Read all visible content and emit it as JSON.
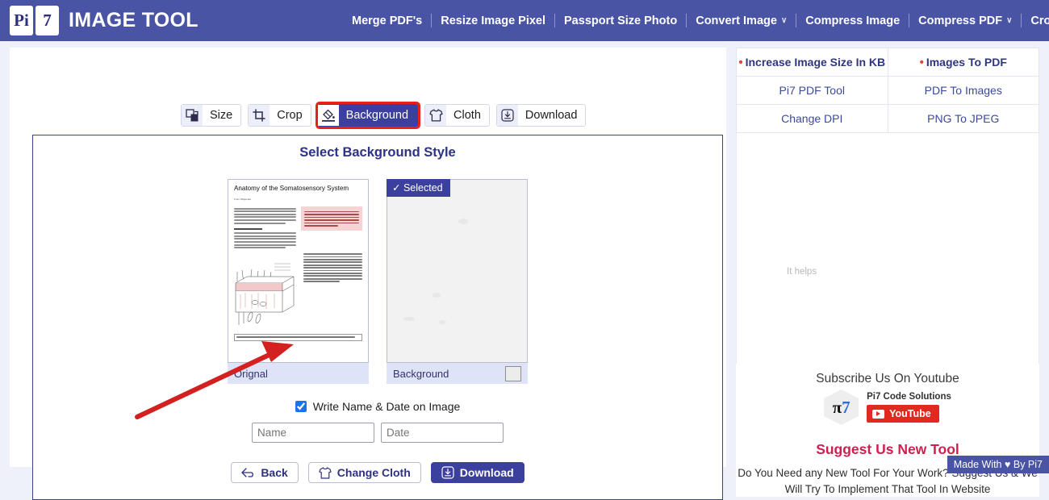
{
  "header": {
    "logo_left": "Pi",
    "logo_right": "7",
    "title": "IMAGE TOOL",
    "nav": [
      {
        "label": "Merge PDF's",
        "caret": false
      },
      {
        "label": "Resize Image Pixel",
        "caret": false
      },
      {
        "label": "Passport Size Photo",
        "caret": false
      },
      {
        "label": "Convert Image",
        "caret": true
      },
      {
        "label": "Compress Image",
        "caret": false
      },
      {
        "label": "Compress PDF",
        "caret": true
      },
      {
        "label": "Crop Image",
        "caret": false
      }
    ],
    "caret_glyph": "∨",
    "bg_color": "#4a54a4"
  },
  "tabs": [
    {
      "label": "Size",
      "icon": "resize-icon",
      "active": false,
      "highlighted": false
    },
    {
      "label": "Crop",
      "icon": "crop-icon",
      "active": false,
      "highlighted": false
    },
    {
      "label": "Background",
      "icon": "paint-bucket-icon",
      "active": true,
      "highlighted": true
    },
    {
      "label": "Cloth",
      "icon": "tshirt-icon",
      "active": false,
      "highlighted": false
    },
    {
      "label": "Download",
      "icon": "download-icon",
      "active": false,
      "highlighted": false
    }
  ],
  "panel": {
    "title": "Select Background Style",
    "thumbnails": [
      {
        "label": "Orignal",
        "selected": false,
        "has_swatch": false,
        "doc": {
          "title": "Anatomy of the Somatosensory System",
          "author": "From Wikipedia",
          "section_heading": "Cutaneous receptors"
        }
      },
      {
        "label": "Background",
        "selected": true,
        "selected_badge": "✓ Selected",
        "has_swatch": true,
        "swatch_color": "#ececec"
      }
    ],
    "checkbox": {
      "label": "Write Name & Date on Image",
      "checked": true
    },
    "inputs": [
      {
        "name": "name",
        "placeholder": "Name",
        "value": ""
      },
      {
        "name": "date",
        "placeholder": "Date",
        "value": ""
      }
    ],
    "buttons": [
      {
        "label": "Back",
        "icon": "back-arrow-icon",
        "primary": false
      },
      {
        "label": "Change Cloth",
        "icon": "tshirt-icon",
        "primary": false
      },
      {
        "label": "Download",
        "icon": "download-icon",
        "primary": true
      }
    ]
  },
  "sidebar": {
    "tools": [
      {
        "label": "Increase Image Size In KB",
        "dot": true,
        "bold": true
      },
      {
        "label": "Images To PDF",
        "dot": true,
        "bold": true
      },
      {
        "label": "Pi7 PDF Tool",
        "dot": false,
        "bold": false
      },
      {
        "label": "PDF To Images",
        "dot": false,
        "bold": false
      },
      {
        "label": "Change DPI",
        "dot": false,
        "bold": false
      },
      {
        "label": "PNG To JPEG",
        "dot": false,
        "bold": false
      }
    ],
    "ad_text": "It helps",
    "subscribe_title": "Subscribe Us On Youtube",
    "channel_name": "Pi7 Code Solutions",
    "youtube_button": "YouTube",
    "logo_pi": "π",
    "logo_seven": "7",
    "suggest_heading": "Suggest Us New Tool",
    "suggest_text": "Do You Need any New Tool For Your Work? Suggest Us & We Will Try To Implement That Tool In Website",
    "made_with": "Made With ♥ By  Pi7"
  },
  "annotation": {
    "arrow_color": "#d32020",
    "points_to": "write-name-date-checkbox"
  }
}
